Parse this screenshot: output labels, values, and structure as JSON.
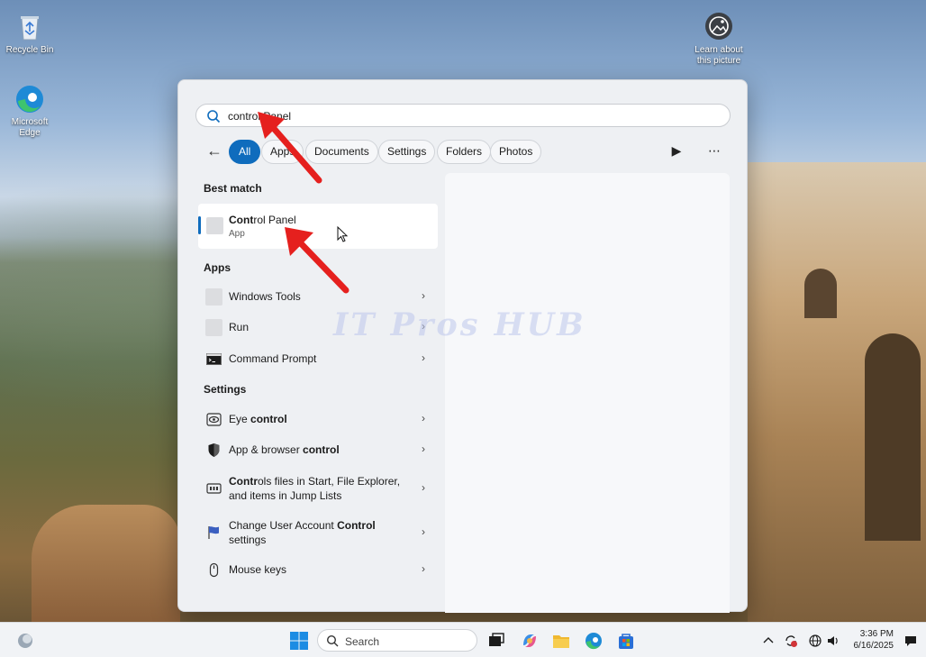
{
  "desktop": {
    "icons": [
      {
        "label": "Recycle Bin"
      },
      {
        "label": "Microsoft Edge"
      },
      {
        "label": "Learn about this picture"
      }
    ],
    "watermark": "IT Pros HUB"
  },
  "search": {
    "value": "control Panel"
  },
  "filters": {
    "chips": [
      "All",
      "Apps",
      "Documents",
      "Settings",
      "Folders",
      "Photos"
    ],
    "active": "All"
  },
  "best_match": {
    "header": "Best match",
    "title_bold": "Cont",
    "title_rest": "rol Panel",
    "subtitle": "App"
  },
  "apps": {
    "header": "Apps",
    "items": [
      {
        "label": "Windows Tools"
      },
      {
        "label": "Run"
      },
      {
        "label": "Command Prompt"
      }
    ]
  },
  "settings": {
    "header": "Settings",
    "items": [
      {
        "pre": "Eye ",
        "bold": "control",
        "post": ""
      },
      {
        "pre": "App & browser ",
        "bold": "control",
        "post": ""
      },
      {
        "pre": "",
        "bold": "Contr",
        "post": "ols files in Start, File Explorer,",
        "line2": "and items in Jump Lists"
      },
      {
        "pre": "Change User Account ",
        "bold": "Control",
        "post": "",
        "line2": "settings"
      },
      {
        "pre": "Mouse keys",
        "bold": "",
        "post": ""
      }
    ]
  },
  "taskbar": {
    "search_label": "Search",
    "time": "3:36 PM",
    "date": "6/16/2025"
  },
  "colors": {
    "accent": "#0f6cbd",
    "arrow": "#e5201e"
  }
}
